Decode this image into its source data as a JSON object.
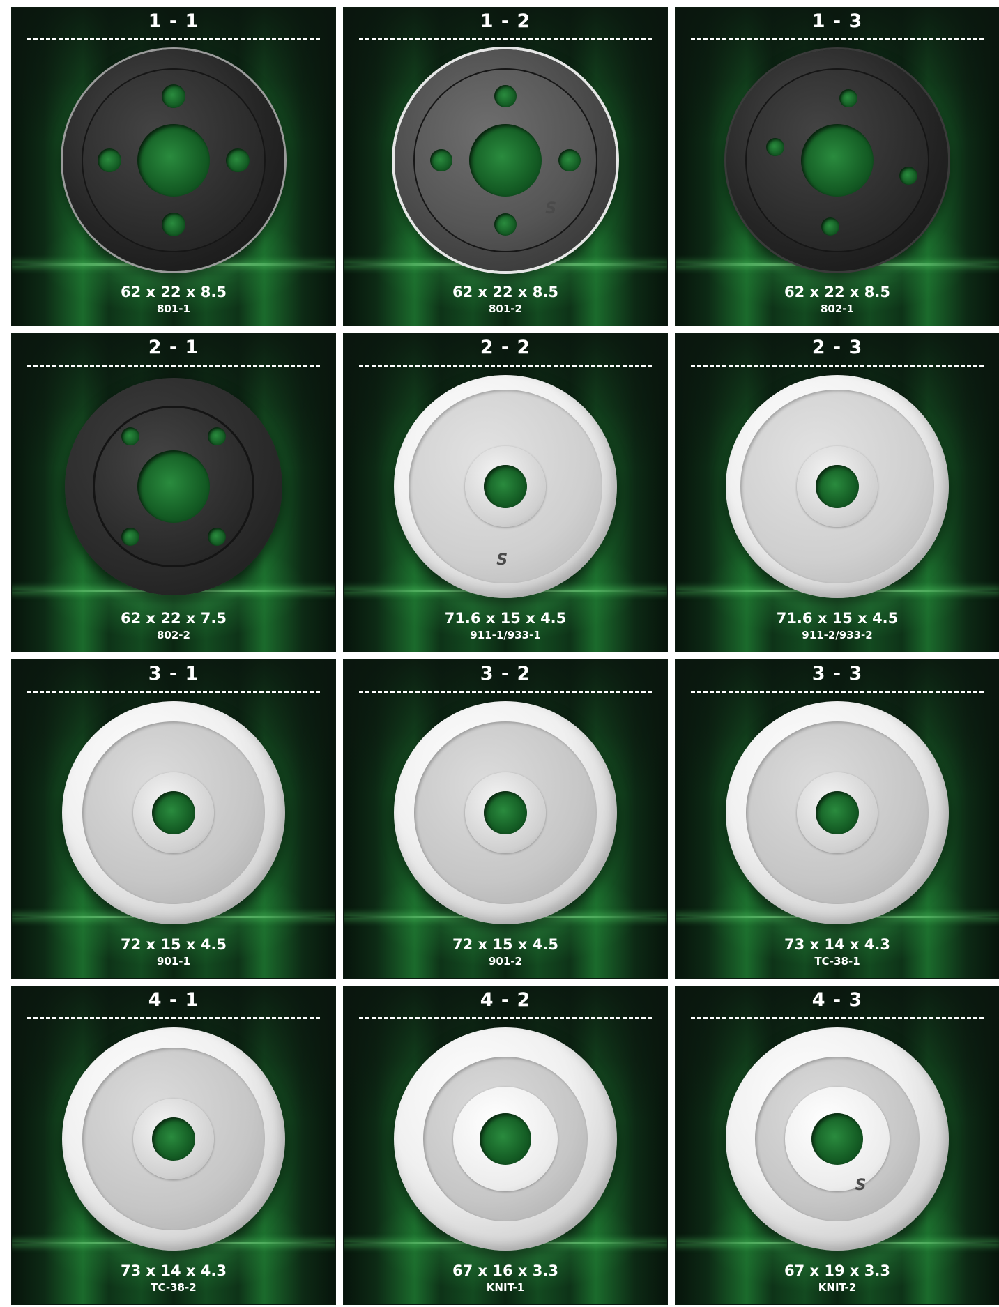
{
  "cells": [
    {
      "label": "1 - 1",
      "size": "62 x 22 x 8.5",
      "code": "801-1",
      "style": "dark"
    },
    {
      "label": "1 - 2",
      "size": "62 x 22 x 8.5",
      "code": "801-2",
      "style": "dark silverrim"
    },
    {
      "label": "1 - 3",
      "size": "62 x 22 x 8.5",
      "code": "802-1",
      "style": "dark knurl"
    },
    {
      "label": "2 - 1",
      "size": "62 x 22 x 7.5",
      "code": "802-2",
      "style": "dark matte"
    },
    {
      "label": "2 - 2",
      "size": "71.6 x 15 x 4.5",
      "code": "911-1/933-1",
      "style": "silver flatface"
    },
    {
      "label": "2 - 3",
      "size": "71.6 x 15 x 4.5",
      "code": "911-2/933-2",
      "style": "silver flatface"
    },
    {
      "label": "3 - 1",
      "size": "72 x 15 x 4.5",
      "code": "901-1",
      "style": "silver"
    },
    {
      "label": "3 - 2",
      "size": "72 x 15 x 4.5",
      "code": "901-2",
      "style": "silver"
    },
    {
      "label": "3 - 3",
      "size": "73 x 14 x 4.3",
      "code": "TC-38-1",
      "style": "silver"
    },
    {
      "label": "4 - 1",
      "size": "73 x 14 x 4.3",
      "code": "TC-38-2",
      "style": "silver"
    },
    {
      "label": "4 - 2",
      "size": "67 x 16 x 3.3",
      "code": "KNIT-1",
      "style": "silver ringed"
    },
    {
      "label": "4 - 3",
      "size": "67 x 19 x 3.3",
      "code": "KNIT-2",
      "style": "silver ringed"
    }
  ],
  "logo": "S"
}
